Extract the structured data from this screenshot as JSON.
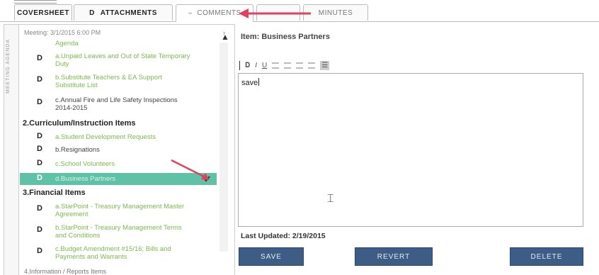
{
  "tabs": [
    {
      "label": "COVERSHEET",
      "style": "bold"
    },
    {
      "label": "ATTACHMENTS",
      "prefix": "D",
      "style": "bold"
    },
    {
      "label": "COMMENTS",
      "style": "light",
      "active": true
    },
    {
      "label": "MINUTES",
      "style": "light"
    }
  ],
  "sidebar": {
    "vertical_label": "MEETING AGENDA",
    "meeting_label": "Meeting: 3/1/2015 6:00 PM",
    "groups": [
      {
        "items": [
          {
            "doc": "D",
            "label": "Agenda",
            "dark": false
          },
          {
            "doc": "D",
            "label": "a.Unpaid Leaves and Out of State Temporary Duty",
            "dark": false
          },
          {
            "doc": "D",
            "label": "b.Substitute Teachers & EA Support Substitute List",
            "dark": false
          },
          {
            "doc": "D",
            "label": "c.Annual Fire and Life Safety Inspections 2014-2015",
            "dark": true
          }
        ]
      },
      {
        "heading": "2.Curriculum/Instruction Items",
        "items": [
          {
            "doc": "D",
            "label": "a.Student Development Requests",
            "dark": false
          },
          {
            "doc": "D",
            "label": "b.Resignations",
            "dark": true
          },
          {
            "doc": "D",
            "label": "c.School Volunteers",
            "dark": false
          },
          {
            "doc": "D",
            "label": "d.Business Partners",
            "dark": false,
            "selected": true
          }
        ]
      },
      {
        "heading": "3.Financial Items",
        "items": [
          {
            "doc": "D",
            "label": "a.StarPoint - Treasury Management Master Agreement",
            "dark": false
          },
          {
            "doc": "D",
            "label": "b.StarPoint - Treasury Management Terms and Conditions",
            "dark": false
          },
          {
            "doc": "D",
            "label": "c.Budget Amendment #15/16; Bills and Payments and Warrants",
            "dark": false
          }
        ]
      }
    ],
    "bottom_fragment": "4.Information / Reports Items"
  },
  "item": {
    "title": "Item: Business Partners",
    "editor_text": "save",
    "last_updated": "Last Updated: 2/19/2015"
  },
  "buttons": {
    "save": "SAVE",
    "revert": "REVERT",
    "delete": "DELETE"
  },
  "colors": {
    "accent_button": "#3d5d86",
    "selected_row": "#5fc1a5",
    "link_green": "#7cb84f",
    "annotation_red": "#e2405e"
  }
}
